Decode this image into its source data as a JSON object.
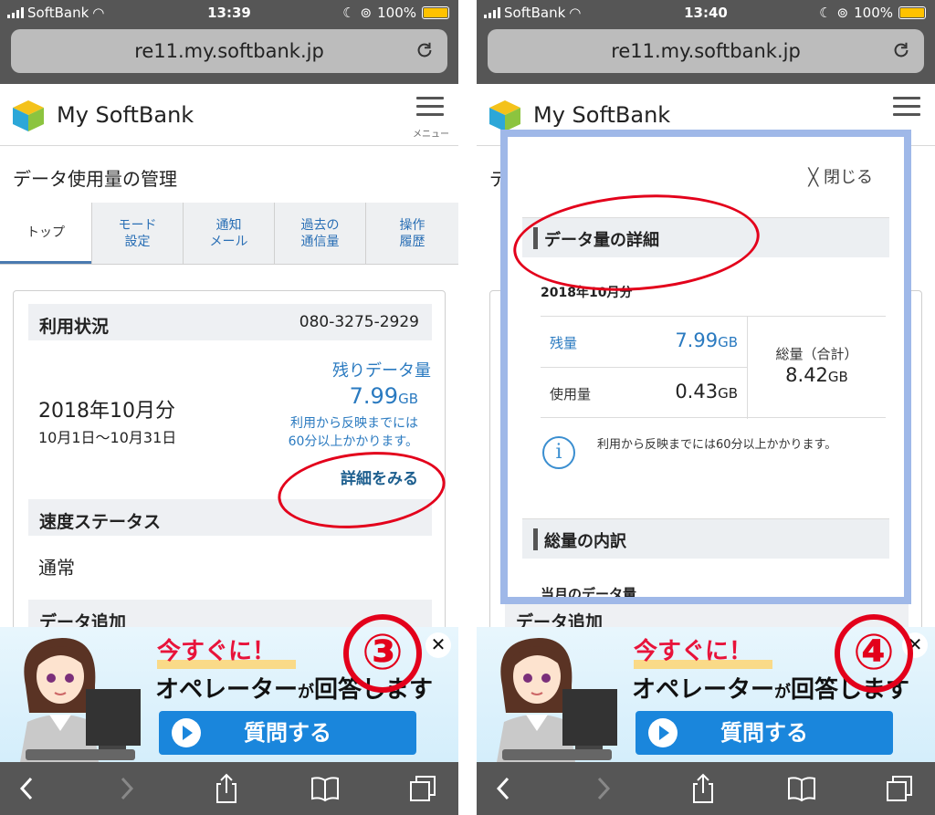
{
  "screens": [
    {
      "status": {
        "carrier": "SoftBank",
        "time": "13:39",
        "battery": "100%"
      },
      "url": "re11.my.softbank.jp",
      "brand": "My SoftBank",
      "menu_label": "メニュー",
      "page_title": "データ使用量の管理",
      "tabs": [
        "トップ",
        "モード\n設定",
        "通知\nメール",
        "過去の\n通信量",
        "操作\n履歴"
      ],
      "usage": {
        "heading": "利用状況",
        "phone": "080-3275-2929",
        "month": "2018年10月分",
        "range": "10月1日〜10月31日",
        "remaining_label": "残りデータ量",
        "remaining_value": "7.99",
        "unit": "GB",
        "note": "利用から反映までには\n60分以上かかります。",
        "detail_link": "詳細をみる"
      },
      "speed": {
        "heading": "速度ステータス",
        "value": "通常"
      },
      "data_add": {
        "heading": "データ追加"
      },
      "banner": {
        "line1": "今すぐに！",
        "line2_a": "オペレーター",
        "line2_b": "が",
        "line2_c": "回答します",
        "button": "質問する"
      },
      "step": "③"
    },
    {
      "status": {
        "carrier": "SoftBank",
        "time": "13:40",
        "battery": "100%"
      },
      "url": "re11.my.softbank.jp",
      "brand": "My SoftBank",
      "page_title_partial": "デ",
      "modal": {
        "close": "閉じる",
        "section1": "データ量の詳細",
        "month": "2018年10月分",
        "remaining_label": "残量",
        "remaining_value": "7.99",
        "used_label": "使用量",
        "used_value": "0.43",
        "unit": "GB",
        "total_label": "総量（合計）",
        "total_value": "8.42",
        "info": "利用から反映までには60分以上かかります。",
        "section2": "総量の内訳",
        "sub": "当月のデータ量"
      },
      "data_add": {
        "heading": "データ追加"
      },
      "banner": {
        "line1": "今すぐに！",
        "line2_a": "オペレーター",
        "line2_b": "が",
        "line2_c": "回答します",
        "button": "質問する"
      },
      "step": "④"
    }
  ],
  "colors": {
    "accent_blue": "#2a7ac0",
    "annotation_red": "#e3001b",
    "banner_button": "#1a86dc",
    "modal_border": "#9fb8e8"
  }
}
